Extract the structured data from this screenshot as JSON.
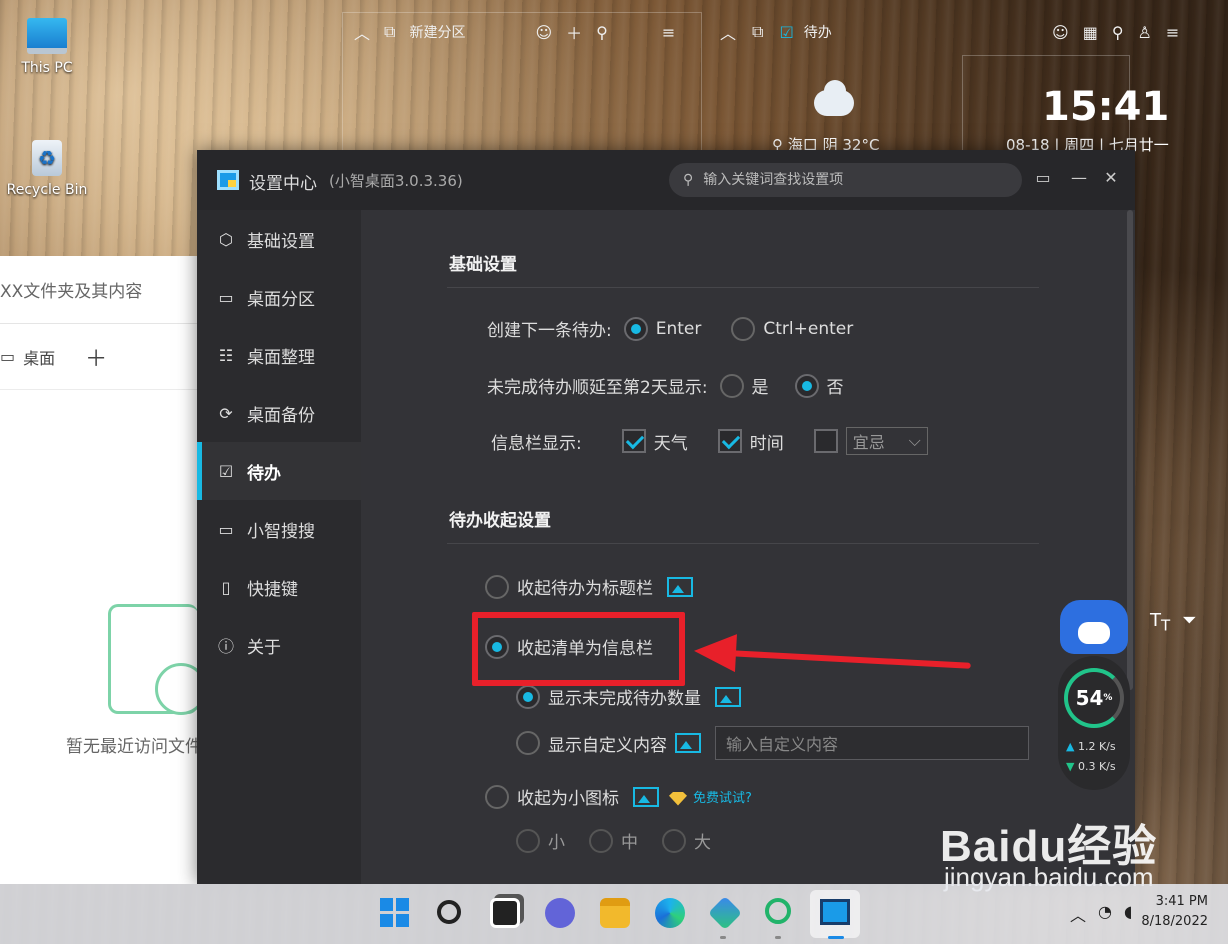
{
  "desktop": {
    "icons": [
      {
        "label": "This PC"
      },
      {
        "label": "Recycle Bin"
      }
    ]
  },
  "partition_bar": {
    "title": "新建分区"
  },
  "todo_bar": {
    "title": "待办"
  },
  "weather": {
    "location": "海口",
    "condition": "阴",
    "temp": "32°C"
  },
  "clock": {
    "time": "15:41",
    "date": "08-18 | 周四 | 七月廿一"
  },
  "explorer": {
    "search_text": "XX文件夹及其内容",
    "tab_label": "桌面",
    "empty_text": "暂无最近访问文件"
  },
  "settings": {
    "title": "设置中心",
    "version": "(小智桌面3.0.3.36)",
    "search_placeholder": "输入关键词查找设置项",
    "nav": [
      {
        "label": "基础设置",
        "icon": "hexagon-icon"
      },
      {
        "label": "桌面分区",
        "icon": "monitor-icon"
      },
      {
        "label": "桌面整理",
        "icon": "grid-icon"
      },
      {
        "label": "桌面备份",
        "icon": "backup-icon"
      },
      {
        "label": "待办",
        "icon": "calendar-check-icon"
      },
      {
        "label": "小智搜搜",
        "icon": "search-window-icon"
      },
      {
        "label": "快捷键",
        "icon": "mouse-icon"
      },
      {
        "label": "关于",
        "icon": "info-icon"
      }
    ],
    "basic": {
      "section_title": "基础设置",
      "create_next_label": "创建下一条待办:",
      "create_opt1": "Enter",
      "create_opt2": "Ctrl+enter",
      "defer_label": "未完成待办顺延至第2天显示:",
      "defer_yes": "是",
      "defer_no": "否",
      "infobar_label": "信息栏显示:",
      "infobar_weather": "天气",
      "infobar_time": "时间",
      "infobar_select": "宜忌"
    },
    "collapse": {
      "section_title": "待办收起设置",
      "opt_titlebar": "收起待办为标题栏",
      "opt_infobar": "收起清单为信息栏",
      "sub_show_count": "显示未完成待办数量",
      "sub_show_custom": "显示自定义内容",
      "custom_placeholder": "输入自定义内容",
      "opt_small_icon": "收起为小图标",
      "free_trial": "免费试试?",
      "size_small": "小",
      "size_medium": "中",
      "size_large": "大"
    }
  },
  "network": {
    "percent": "54",
    "percent_unit": "%",
    "up": "1.2",
    "down": "0.3",
    "unit": "K/s"
  },
  "taskbar": {
    "time": "3:41 PM",
    "date": "8/18/2022"
  },
  "watermark": {
    "brand": "Baidu经验",
    "url": "jingyan.baidu.com"
  }
}
